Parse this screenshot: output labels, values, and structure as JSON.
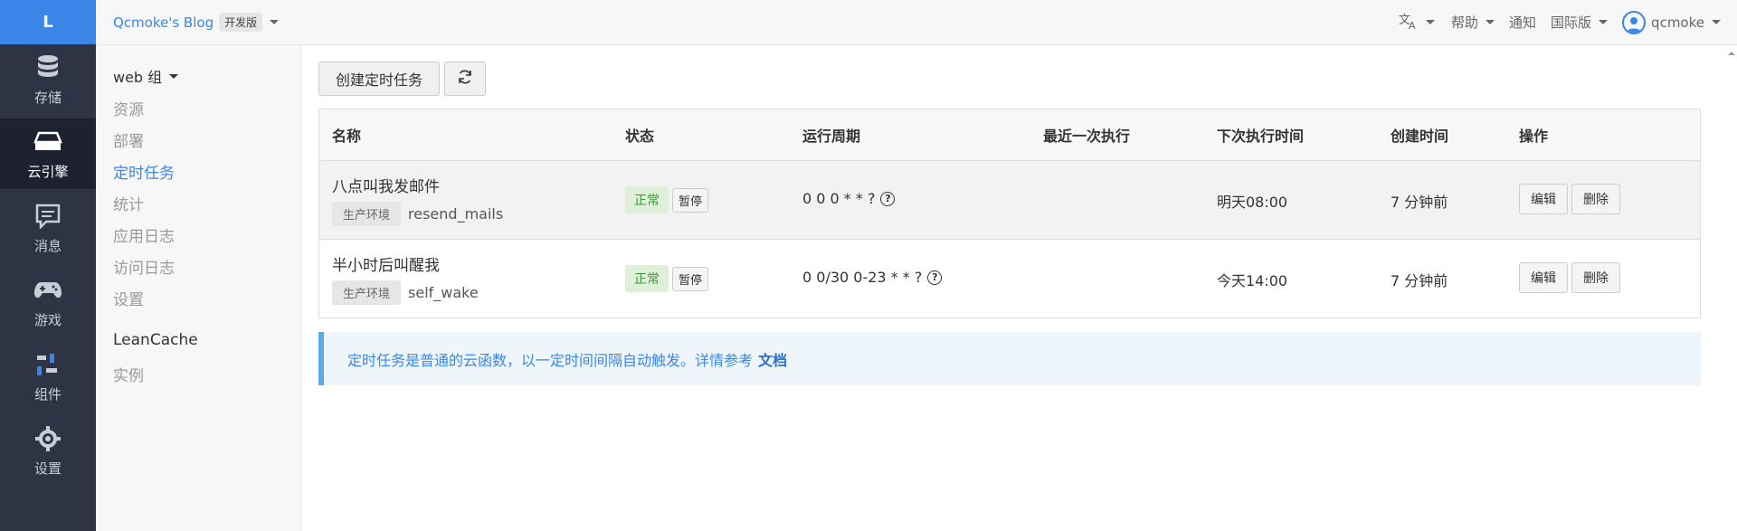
{
  "brand": {
    "logo_letter": "L",
    "accent": "#3b86e8",
    "nav_bg": "#2f3444"
  },
  "leftnav": [
    {
      "label": "存储",
      "icon": "database-icon"
    },
    {
      "label": "云引擎",
      "icon": "server-icon",
      "active": true
    },
    {
      "label": "消息",
      "icon": "message-icon"
    },
    {
      "label": "游戏",
      "icon": "gamepad-icon"
    },
    {
      "label": "组件",
      "icon": "components-icon"
    },
    {
      "label": "设置",
      "icon": "gear-icon"
    }
  ],
  "topbar": {
    "app_name": "Qcmoke's Blog",
    "app_badge": "开发版",
    "translate_icon": "translate-icon",
    "help": "帮助",
    "notify": "通知",
    "region": "国际版",
    "user": "qcmoke"
  },
  "subnav": {
    "group1": "web 组",
    "items1": [
      "资源",
      "部署",
      "定时任务",
      "统计",
      "应用日志",
      "访问日志",
      "设置"
    ],
    "active_item": "定时任务",
    "group2": "LeanCache",
    "items2": [
      "实例"
    ]
  },
  "toolbar": {
    "create_label": "创建定时任务",
    "refresh_icon": "refresh-icon"
  },
  "table": {
    "headers": [
      "名称",
      "状态",
      "运行周期",
      "最近一次执行",
      "下次执行时间",
      "创建时间",
      "操作"
    ],
    "rows": [
      {
        "title": "八点叫我发邮件",
        "env": "生产环境",
        "func": "resend_mails",
        "status": "正常",
        "pause": "暂停",
        "cron": "0 0 0 * * ?",
        "last_run": "",
        "next_run": "明天08:00",
        "created": "7 分钟前",
        "edit": "编辑",
        "delete": "删除"
      },
      {
        "title": "半小时后叫醒我",
        "env": "生产环境",
        "func": "self_wake",
        "status": "正常",
        "pause": "暂停",
        "cron": "0 0/30 0-23 * * ?",
        "last_run": "",
        "next_run": "今天14:00",
        "created": "7 分钟前",
        "edit": "编辑",
        "delete": "删除"
      }
    ]
  },
  "notice": {
    "text": "定时任务是普通的云函数，以一定时间间隔自动触发。详情参考",
    "link": "文档"
  }
}
